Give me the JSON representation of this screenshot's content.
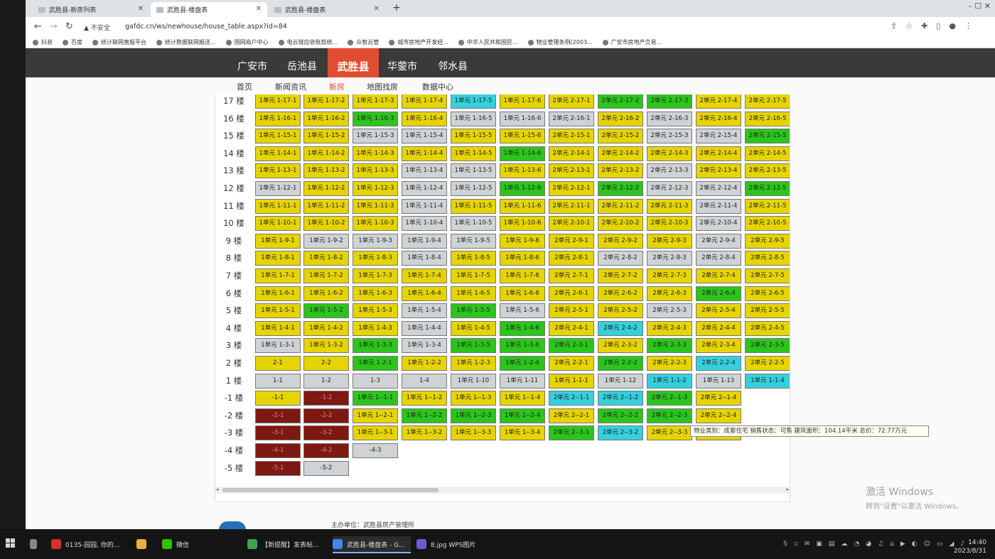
{
  "browser": {
    "tabs": [
      {
        "label": "武胜县-新房列表",
        "active": false
      },
      {
        "label": "武胜县-楼盘表",
        "active": true
      },
      {
        "label": "武胜县-楼盘表",
        "active": false
      }
    ],
    "new_tab": "+",
    "window_controls": "–  ☐  ✕",
    "security": "不安全",
    "url": "gafdc.cn/ws/newhouse/house_table.aspx?id=84",
    "bookmarks": [
      "抖音",
      "百度",
      "统计联网直报平台",
      "统计数据联网报送...",
      "国网商户中心",
      "电云链应收账款统...",
      "众智云管",
      "城市房地产开发经...",
      "中华人民共和国民...",
      "物业管理条例(2003...",
      "广安市房地产交易..."
    ]
  },
  "site": {
    "cities": [
      {
        "label": "广安市",
        "active": false
      },
      {
        "label": "岳池县",
        "active": false
      },
      {
        "label": "武胜县",
        "active": true
      },
      {
        "label": "华蓥市",
        "active": false
      },
      {
        "label": "邻水县",
        "active": false
      }
    ],
    "subnav": [
      {
        "label": "首页",
        "active": false
      },
      {
        "label": "新闻资讯",
        "active": false
      },
      {
        "label": "新房",
        "active": true
      },
      {
        "label": "地图找房",
        "active": false
      },
      {
        "label": "数据中心",
        "active": false
      }
    ],
    "floor_suffix": "楼",
    "tooltip": "物业类别：成套住宅  销售状态：可售  建筑面积：104.14平米  总价：72.77万元",
    "footer": "主办单位：武胜县房产管理所",
    "watermark_title": "激活 Windows",
    "watermark_sub": "转到\"设置\"以激活 Windows。"
  },
  "legend_colors": {
    "y": "#e6d400",
    "g": "#2cc51c",
    "s": "#cfd3d6",
    "c": "#35d0dc",
    "r": "#7e1812"
  },
  "building_table": {
    "rows": [
      {
        "floor": "17",
        "cells": [
          [
            "1单元 1-17-1",
            "y"
          ],
          [
            "1单元 1-17-2",
            "y"
          ],
          [
            "1单元 1-17-3",
            "y"
          ],
          [
            "1单元 1-17-4",
            "y"
          ],
          [
            "1单元 1-17-5",
            "c"
          ],
          [
            "1单元 1-17-6",
            "y"
          ],
          [
            "2单元 2-17-1",
            "y"
          ],
          [
            "2单元 2-17-2",
            "g"
          ],
          [
            "2单元 2-17-3",
            "g"
          ],
          [
            "2单元 2-17-4",
            "y"
          ],
          [
            "2单元 2-17-5",
            "y"
          ]
        ]
      },
      {
        "floor": "16",
        "cells": [
          [
            "1单元 1-16-1",
            "y"
          ],
          [
            "1单元 1-16-2",
            "y"
          ],
          [
            "1单元 1-16-3",
            "g"
          ],
          [
            "1单元 1-16-4",
            "y"
          ],
          [
            "1单元 1-16-5",
            "s"
          ],
          [
            "1单元 1-16-6",
            "s"
          ],
          [
            "2单元 2-16-1",
            "s"
          ],
          [
            "2单元 2-16-2",
            "y"
          ],
          [
            "2单元 2-16-3",
            "s"
          ],
          [
            "2单元 2-16-4",
            "y"
          ],
          [
            "2单元 2-16-5",
            "y"
          ]
        ]
      },
      {
        "floor": "15",
        "cells": [
          [
            "1单元 1-15-1",
            "y"
          ],
          [
            "1单元 1-15-2",
            "y"
          ],
          [
            "1单元 1-15-3",
            "s"
          ],
          [
            "1单元 1-15-4",
            "s"
          ],
          [
            "1单元 1-15-5",
            "y"
          ],
          [
            "1单元 1-15-6",
            "y"
          ],
          [
            "2单元 2-15-1",
            "y"
          ],
          [
            "2单元 2-15-2",
            "y"
          ],
          [
            "2单元 2-15-3",
            "s"
          ],
          [
            "2单元 2-15-4",
            "s"
          ],
          [
            "2单元 2-15-5",
            "g"
          ]
        ]
      },
      {
        "floor": "14",
        "cells": [
          [
            "1单元 1-14-1",
            "y"
          ],
          [
            "1单元 1-14-2",
            "y"
          ],
          [
            "1单元 1-14-3",
            "y"
          ],
          [
            "1单元 1-14-4",
            "y"
          ],
          [
            "1单元 1-14-5",
            "y"
          ],
          [
            "1单元 1-14-6",
            "g"
          ],
          [
            "2单元 2-14-1",
            "y"
          ],
          [
            "2单元 2-14-2",
            "y"
          ],
          [
            "2单元 2-14-3",
            "y"
          ],
          [
            "2单元 2-14-4",
            "y"
          ],
          [
            "2单元 2-14-5",
            "y"
          ]
        ]
      },
      {
        "floor": "13",
        "cells": [
          [
            "1单元 1-13-1",
            "y"
          ],
          [
            "1单元 1-13-2",
            "y"
          ],
          [
            "1单元 1-13-3",
            "y"
          ],
          [
            "1单元 1-13-4",
            "s"
          ],
          [
            "1单元 1-13-5",
            "s"
          ],
          [
            "1单元 1-13-6",
            "y"
          ],
          [
            "2单元 2-13-1",
            "y"
          ],
          [
            "2单元 2-13-2",
            "y"
          ],
          [
            "2单元 2-13-3",
            "s"
          ],
          [
            "2单元 2-13-4",
            "y"
          ],
          [
            "2单元 2-13-5",
            "y"
          ]
        ]
      },
      {
        "floor": "12",
        "cells": [
          [
            "1单元 1-12-1",
            "s"
          ],
          [
            "1单元 1-12-2",
            "y"
          ],
          [
            "1单元 1-12-3",
            "y"
          ],
          [
            "1单元 1-12-4",
            "s"
          ],
          [
            "1单元 1-12-5",
            "s"
          ],
          [
            "1单元 1-12-6",
            "g"
          ],
          [
            "2单元 2-12-1",
            "y"
          ],
          [
            "2单元 2-12-2",
            "g"
          ],
          [
            "2单元 2-12-3",
            "s"
          ],
          [
            "2单元 2-12-4",
            "s"
          ],
          [
            "2单元 2-12-5",
            "g"
          ]
        ]
      },
      {
        "floor": "11",
        "cells": [
          [
            "1单元 1-11-1",
            "y"
          ],
          [
            "1单元 1-11-2",
            "y"
          ],
          [
            "1单元 1-11-3",
            "y"
          ],
          [
            "1单元 1-11-4",
            "s"
          ],
          [
            "1单元 1-11-5",
            "y"
          ],
          [
            "1单元 1-11-6",
            "y"
          ],
          [
            "2单元 2-11-1",
            "y"
          ],
          [
            "2单元 2-11-2",
            "y"
          ],
          [
            "2单元 2-11-3",
            "y"
          ],
          [
            "2单元 2-11-4",
            "s"
          ],
          [
            "2单元 2-11-5",
            "y"
          ]
        ]
      },
      {
        "floor": "10",
        "cells": [
          [
            "1单元 1-10-1",
            "y"
          ],
          [
            "1单元 1-10-2",
            "y"
          ],
          [
            "1单元 1-10-3",
            "y"
          ],
          [
            "1单元 1-10-4",
            "s"
          ],
          [
            "1单元 1-10-5",
            "s"
          ],
          [
            "1单元 1-10-6",
            "y"
          ],
          [
            "2单元 2-10-1",
            "y"
          ],
          [
            "2单元 2-10-2",
            "y"
          ],
          [
            "2单元 2-10-3",
            "y"
          ],
          [
            "2单元 2-10-4",
            "s"
          ],
          [
            "2单元 2-10-5",
            "y"
          ]
        ]
      },
      {
        "floor": "9",
        "cells": [
          [
            "1单元 1-9-1",
            "y"
          ],
          [
            "1单元 1-9-2",
            "s"
          ],
          [
            "1单元 1-9-3",
            "s"
          ],
          [
            "1单元 1-9-4",
            "s"
          ],
          [
            "1单元 1-9-5",
            "s"
          ],
          [
            "1单元 1-9-6",
            "y"
          ],
          [
            "2单元 2-9-1",
            "y"
          ],
          [
            "2单元 2-9-2",
            "y"
          ],
          [
            "2单元 2-9-3",
            "y"
          ],
          [
            "2单元 2-9-4",
            "s"
          ],
          [
            "2单元 2-9-5",
            "y"
          ]
        ]
      },
      {
        "floor": "8",
        "cells": [
          [
            "1单元 1-8-1",
            "y"
          ],
          [
            "1单元 1-8-2",
            "y"
          ],
          [
            "1单元 1-8-3",
            "y"
          ],
          [
            "1单元 1-8-4",
            "s"
          ],
          [
            "1单元 1-8-5",
            "y"
          ],
          [
            "1单元 1-8-6",
            "y"
          ],
          [
            "2单元 2-8-1",
            "y"
          ],
          [
            "2单元 2-8-2",
            "s"
          ],
          [
            "2单元 2-8-3",
            "s"
          ],
          [
            "2单元 2-8-4",
            "s"
          ],
          [
            "2单元 2-8-5",
            "y"
          ]
        ]
      },
      {
        "floor": "7",
        "cells": [
          [
            "1单元 1-7-1",
            "y"
          ],
          [
            "1单元 1-7-2",
            "y"
          ],
          [
            "1单元 1-7-3",
            "y"
          ],
          [
            "1单元 1-7-4",
            "y"
          ],
          [
            "1单元 1-7-5",
            "y"
          ],
          [
            "1单元 1-7-6",
            "y"
          ],
          [
            "2单元 2-7-1",
            "y"
          ],
          [
            "2单元 2-7-2",
            "y"
          ],
          [
            "2单元 2-7-3",
            "y"
          ],
          [
            "2单元 2-7-4",
            "y"
          ],
          [
            "2单元 2-7-5",
            "y"
          ]
        ]
      },
      {
        "floor": "6",
        "cells": [
          [
            "1单元 1-6-1",
            "y"
          ],
          [
            "1单元 1-6-2",
            "y"
          ],
          [
            "1单元 1-6-3",
            "y"
          ],
          [
            "1单元 1-6-4",
            "y"
          ],
          [
            "1单元 1-6-5",
            "y"
          ],
          [
            "1单元 1-6-6",
            "y"
          ],
          [
            "2单元 2-6-1",
            "y"
          ],
          [
            "2单元 2-6-2",
            "y"
          ],
          [
            "2单元 2-6-3",
            "y"
          ],
          [
            "2单元 2-6-4",
            "g"
          ],
          [
            "2单元 2-6-5",
            "y"
          ]
        ]
      },
      {
        "floor": "5",
        "cells": [
          [
            "1单元 1-5-1",
            "y"
          ],
          [
            "1单元 1-5-2",
            "g"
          ],
          [
            "1单元 1-5-3",
            "y"
          ],
          [
            "1单元 1-5-4",
            "s"
          ],
          [
            "1单元 1-5-5",
            "g"
          ],
          [
            "1单元 1-5-6",
            "s"
          ],
          [
            "2单元 2-5-1",
            "y"
          ],
          [
            "2单元 2-5-2",
            "y"
          ],
          [
            "2单元 2-5-3",
            "s"
          ],
          [
            "2单元 2-5-4",
            "y"
          ],
          [
            "2单元 2-5-5",
            "y"
          ]
        ]
      },
      {
        "floor": "4",
        "cells": [
          [
            "1单元 1-4-1",
            "y"
          ],
          [
            "1单元 1-4-2",
            "y"
          ],
          [
            "1单元 1-4-3",
            "y"
          ],
          [
            "1单元 1-4-4",
            "s"
          ],
          [
            "1单元 1-4-5",
            "y"
          ],
          [
            "1单元 1-4-6",
            "g"
          ],
          [
            "2单元 2-4-1",
            "y"
          ],
          [
            "2单元 2-4-2",
            "c"
          ],
          [
            "2单元 2-4-3",
            "y"
          ],
          [
            "2单元 2-4-4",
            "y"
          ],
          [
            "2单元 2-4-5",
            "y"
          ]
        ]
      },
      {
        "floor": "3",
        "cells": [
          [
            "1单元 1-3-1",
            "s"
          ],
          [
            "1单元 1-3-2",
            "y"
          ],
          [
            "1单元 1-3-3",
            "g"
          ],
          [
            "1单元 1-3-4",
            "s"
          ],
          [
            "1单元 1-3-5",
            "g"
          ],
          [
            "1单元 1-3-6",
            "g"
          ],
          [
            "2单元 2-3-1",
            "g"
          ],
          [
            "2单元 2-3-2",
            "y"
          ],
          [
            "2单元 2-3-3",
            "g"
          ],
          [
            "2单元 2-3-4",
            "y"
          ],
          [
            "2单元 2-3-5",
            "g"
          ]
        ]
      },
      {
        "floor": "2",
        "cells": [
          [
            "2-1",
            "y"
          ],
          [
            "2-2",
            "y"
          ],
          [
            "1单元 1-2-1",
            "g"
          ],
          [
            "1单元 1-2-2",
            "y"
          ],
          [
            "1单元 1-2-3",
            "y"
          ],
          [
            "1单元 1-2-4",
            "g"
          ],
          [
            "2单元 2-2-1",
            "y"
          ],
          [
            "2单元 2-2-2",
            "g"
          ],
          [
            "2单元 2-2-3",
            "y"
          ],
          [
            "2单元 2-2-4",
            "c"
          ],
          [
            "2单元 2-2-5",
            "y"
          ]
        ]
      },
      {
        "floor": "1",
        "cells": [
          [
            "1-1",
            "s"
          ],
          [
            "1-2",
            "s"
          ],
          [
            "1-3",
            "s"
          ],
          [
            "1-4",
            "s"
          ],
          [
            "1单元 1-10",
            "s"
          ],
          [
            "1单元 1-11",
            "s"
          ],
          [
            "1单元 1-1-1",
            "y"
          ],
          [
            "1单元 1-12",
            "s"
          ],
          [
            "1单元 1-1-2",
            "c"
          ],
          [
            "1单元 1-13",
            "s"
          ],
          [
            "1单元 1-1-4",
            "c"
          ]
        ]
      },
      {
        "floor": "-1",
        "cells": [
          [
            "-1-1",
            "y"
          ],
          [
            "-1-2",
            "r"
          ],
          [
            "1单元 1--1-1",
            "g"
          ],
          [
            "1单元 1--1-2",
            "y"
          ],
          [
            "1单元 1--1-3",
            "y"
          ],
          [
            "1单元 1--1-4",
            "y"
          ],
          [
            "2单元 2--1-1",
            "c"
          ],
          [
            "2单元 2--1-2",
            "c"
          ],
          [
            "2单元 2--1-3",
            "g"
          ],
          [
            "2单元 2--1-4",
            "y"
          ],
          null
        ]
      },
      {
        "floor": "-2",
        "cells": [
          [
            "-2-1",
            "r"
          ],
          [
            "-2-2",
            "r"
          ],
          [
            "1单元 1--2-1",
            "y"
          ],
          [
            "1单元 1--2-2",
            "g"
          ],
          [
            "1单元 1--2-3",
            "g"
          ],
          [
            "1单元 1--2-4",
            "g"
          ],
          [
            "2单元 2--2-1",
            "y"
          ],
          [
            "2单元 2--2-2",
            "g"
          ],
          [
            "2单元 2--2-3",
            "g"
          ],
          [
            "2单元 2--2-4",
            "y"
          ],
          null
        ]
      },
      {
        "floor": "-3",
        "cells": [
          [
            "-3-1",
            "r"
          ],
          [
            "-3-2",
            "r"
          ],
          [
            "1单元 1--3-1",
            "y"
          ],
          [
            "1单元 1--3-2",
            "y"
          ],
          [
            "1单元 1--3-3",
            "y"
          ],
          [
            "1单元 1--3-4",
            "y"
          ],
          [
            "2单元 2--3-1",
            "g"
          ],
          [
            "2单元 2--3-2",
            "c"
          ],
          [
            "2单元 2--3-3",
            "y"
          ],
          [
            "2单元 2--3-4",
            "y"
          ],
          null
        ]
      },
      {
        "floor": "-4",
        "cells": [
          [
            "-4-1",
            "r"
          ],
          [
            "-4-2",
            "r"
          ],
          [
            "-4-3",
            "s"
          ],
          null,
          null,
          null,
          null,
          null,
          null,
          null,
          null
        ]
      },
      {
        "floor": "-5",
        "cells": [
          [
            "-5-1",
            "r"
          ],
          [
            "-5-2",
            "s"
          ],
          null,
          null,
          null,
          null,
          null,
          null,
          null,
          null,
          null
        ]
      }
    ]
  },
  "taskbar": {
    "items": [
      {
        "label": "0135-园园, 你的...",
        "color": "#d9302c"
      },
      {
        "label": "",
        "color": "#e3b341"
      },
      {
        "label": "微信",
        "color": "#2dc100"
      },
      {
        "label": "【新提醒】发表帖...",
        "color": "#3fa34d"
      },
      {
        "label": "武胜县-楼盘表 - G...",
        "color": "#4285f4"
      },
      {
        "label": "8.jpg  WPS图片",
        "color": "#6b5bd2"
      }
    ],
    "time": "14:40",
    "date": "2023/8/31"
  }
}
